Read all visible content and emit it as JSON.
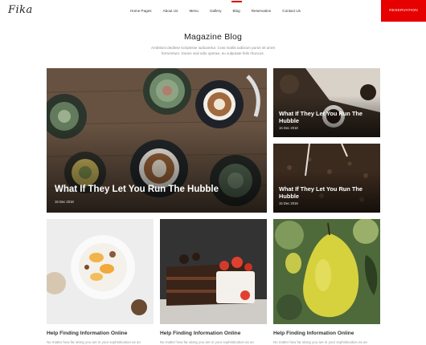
{
  "header": {
    "logo": "Fika",
    "nav": [
      "Home Pages",
      "About Us",
      "Menu",
      "Gallery",
      "Blog",
      "Reservation",
      "Contact Us"
    ],
    "active": "Blog",
    "reservation_button": "RESERVATION"
  },
  "intro": {
    "title": "Magazine Blog",
    "text": "Ambitioni dedisse scripsisse iudicaretur. Cras mattis iudicium purus sit amet fermentum. Donec sed odio operae, eu vulputate felis rhoncus."
  },
  "posts": {
    "featured": {
      "title": "What If They Let You Run The Hubble",
      "date": "15 Dec 2018"
    },
    "side": [
      {
        "title": "What If They Let You Run The Hubble",
        "date": "15 Dec 2018"
      },
      {
        "title": "What If They Let You Run The Hubble",
        "date": "15 Dec 2018"
      }
    ],
    "bottom": [
      {
        "title": "Help Finding Information Online",
        "excerpt": "No matter how far along you are in your sophistication as an"
      },
      {
        "title": "Help Finding Information Online",
        "excerpt": "No matter how far along you are in your sophistication as an"
      },
      {
        "title": "Help Finding Information Online",
        "excerpt": "No matter how far along you are in your sophistication as an"
      }
    ]
  },
  "colors": {
    "accent": "#e60000"
  }
}
